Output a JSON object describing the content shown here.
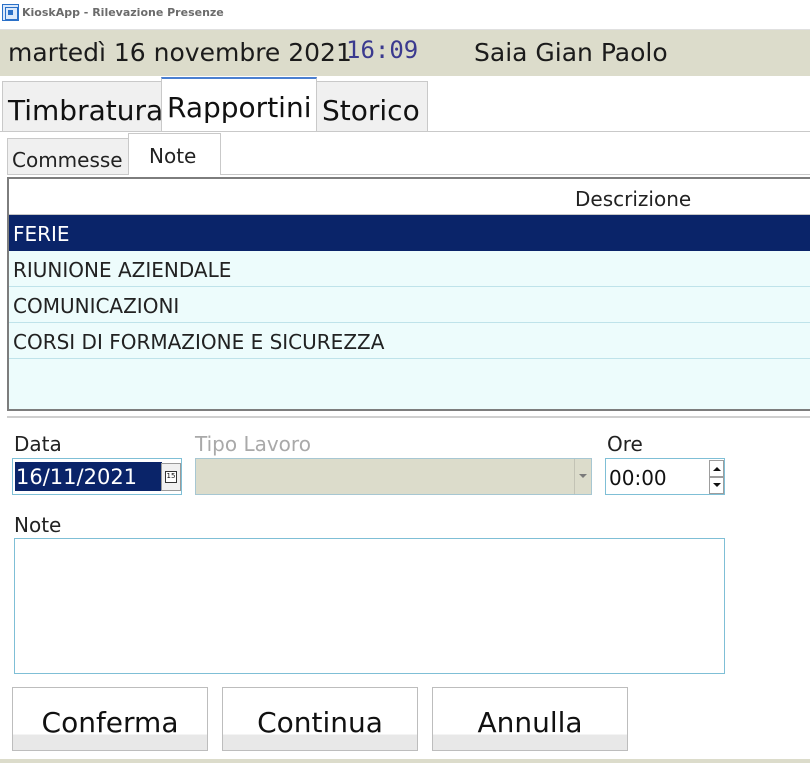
{
  "window": {
    "title": "KioskApp - Rilevazione Presenze"
  },
  "header": {
    "date": "martedì 16 novembre 2021",
    "time": "16:09",
    "user": "Saia Gian Paolo"
  },
  "main_tabs": [
    {
      "label": "Timbratura",
      "active": false
    },
    {
      "label": "Rapportini",
      "active": true
    },
    {
      "label": "Storico",
      "active": false
    }
  ],
  "sub_tabs": [
    {
      "label": "Commesse",
      "active": false
    },
    {
      "label": "Note",
      "active": true
    }
  ],
  "grid": {
    "column_header": "Descrizione",
    "rows": [
      {
        "label": "FERIE",
        "selected": true
      },
      {
        "label": "RIUNIONE AZIENDALE",
        "selected": false
      },
      {
        "label": "COMUNICAZIONI",
        "selected": false
      },
      {
        "label": "CORSI DI FORMAZIONE E SICUREZZA",
        "selected": false
      }
    ]
  },
  "form": {
    "data_label": "Data",
    "data_value": "16/11/2021",
    "calendar_glyph": "15",
    "tipo_label": "Tipo Lavoro",
    "tipo_value": "",
    "ore_label": "Ore",
    "ore_value": "00:00",
    "note_label": "Note",
    "note_value": ""
  },
  "buttons": {
    "conferma": "Conferma",
    "continua": "Continua",
    "annulla": "Annulla"
  },
  "colors": {
    "header_bg": "#dcdccb",
    "selection": "#0a2469",
    "grid_row_bg": "#edfcfc",
    "time_text": "#3b3a8f",
    "input_border": "#7fbfd6"
  },
  "icons": [
    "app-icon",
    "calendar-icon",
    "chevron-down-icon",
    "spin-up-icon",
    "spin-down-icon"
  ]
}
